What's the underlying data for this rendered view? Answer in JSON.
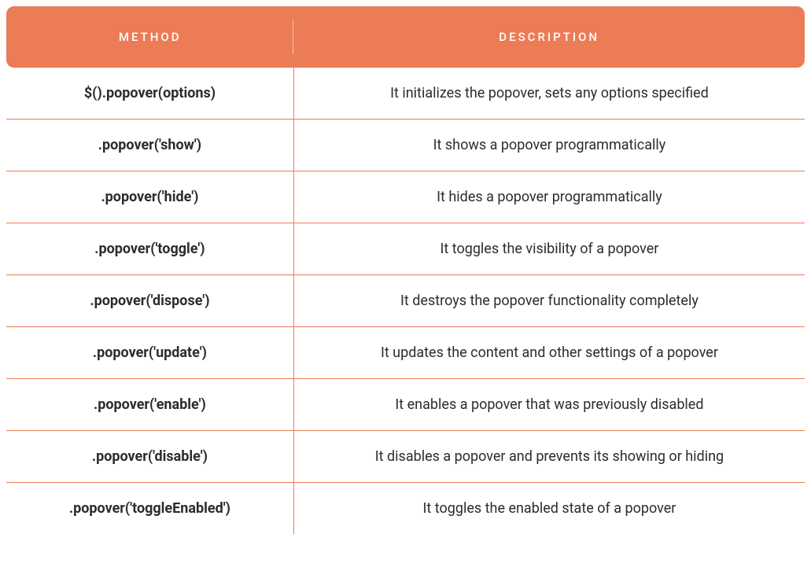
{
  "chart_data": {
    "type": "table",
    "columns": [
      "METHOD",
      "DESCRIPTION"
    ],
    "rows": [
      {
        "method": "$().popover(options)",
        "description": "It initializes the popover, sets any options specified"
      },
      {
        "method": ".popover('show')",
        "description": "It shows a popover programmatically"
      },
      {
        "method": ".popover('hide')",
        "description": "It hides a popover programmatically"
      },
      {
        "method": ".popover('toggle')",
        "description": "It toggles the visibility of a popover"
      },
      {
        "method": ".popover('dispose')",
        "description": "It destroys the popover functionality completely"
      },
      {
        "method": ".popover('update')",
        "description": "It updates the content and other settings of a popover"
      },
      {
        "method": ".popover('enable')",
        "description": "It enables a popover that was previously disabled"
      },
      {
        "method": ".popover('disable')",
        "description": "It disables a popover and prevents its showing or hiding"
      },
      {
        "method": ".popover('toggleEnabled')",
        "description": "It toggles the enabled state of a popover"
      }
    ]
  }
}
